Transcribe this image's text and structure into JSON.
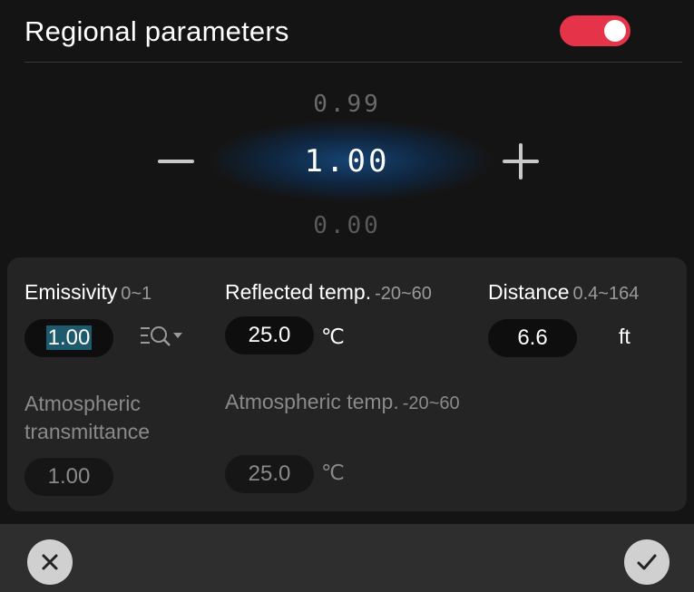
{
  "header": {
    "title": "Regional parameters",
    "toggle_on": true,
    "toggle_color": "#e5344a"
  },
  "picker": {
    "prev_value": "0.99",
    "current_value": "1.00",
    "next_value": "0.00",
    "decrement_icon": "minus-icon",
    "increment_icon": "plus-icon"
  },
  "params": {
    "emissivity": {
      "label": "Emissivity",
      "range": "0~1",
      "value": "1.00",
      "tool_icon": "lens-search-dropdown-icon"
    },
    "reflected_temp": {
      "label": "Reflected temp.",
      "range": "-20~60",
      "value": "25.0",
      "unit": "℃"
    },
    "distance": {
      "label": "Distance",
      "range": "0.4~164",
      "value": "6.6",
      "unit": "ft"
    },
    "atmospheric_transmittance": {
      "label_line1": "Atmospheric",
      "label_line2": "transmittance",
      "value": "1.00"
    },
    "atmospheric_temp": {
      "label": "Atmospheric temp.",
      "range": "-20~60",
      "value": "25.0",
      "unit": "℃"
    }
  },
  "footer": {
    "cancel_icon": "close-icon",
    "confirm_icon": "check-icon"
  }
}
